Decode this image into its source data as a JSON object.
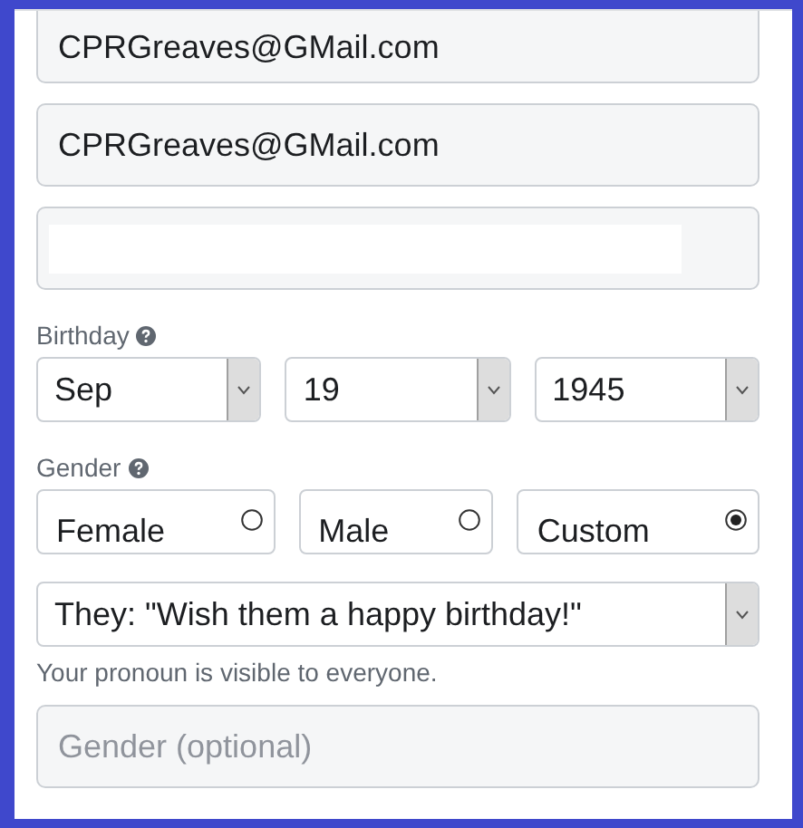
{
  "email_field": {
    "value": "CPRGreaves@GMail.com"
  },
  "confirm_email_field": {
    "value": "CPRGreaves@GMail.com"
  },
  "password_field": {
    "kind": "redacted"
  },
  "birthday": {
    "label": "Birthday",
    "selects": [
      {
        "value": "Sep"
      },
      {
        "value": "19"
      },
      {
        "value": "1945"
      }
    ]
  },
  "gender": {
    "label": "Gender",
    "options": [
      {
        "label": "Female",
        "selected": false
      },
      {
        "label": "Male",
        "selected": false
      },
      {
        "label": "Custom",
        "selected": true
      }
    ]
  },
  "pronoun": {
    "value": "They: \"Wish them a happy birthday!\"",
    "note": "Your pronoun is visible to everyone."
  },
  "gender_optional": {
    "placeholder": "Gender (optional)"
  }
}
